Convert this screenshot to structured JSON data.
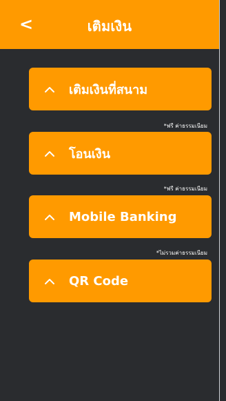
{
  "header": {
    "back_label": "<",
    "title": "เติมเงิน"
  },
  "options": [
    {
      "label": "เติมเงินที่สนาม",
      "note": ""
    },
    {
      "label": "โอนเงิน",
      "note": "*ฟรี ค่าธรรมเนียม"
    },
    {
      "label": "Mobile Banking",
      "note": "*ฟรี ค่าธรรมเนียม"
    },
    {
      "label": "QR Code",
      "note": "*ไม่รวมค่าธรรมเนียม"
    }
  ],
  "colors": {
    "accent": "#ff9a00",
    "background": "#2a2c2f",
    "text": "#ffffff"
  },
  "icons": {
    "back": "back-icon",
    "expand": "chevron-up-icon"
  }
}
